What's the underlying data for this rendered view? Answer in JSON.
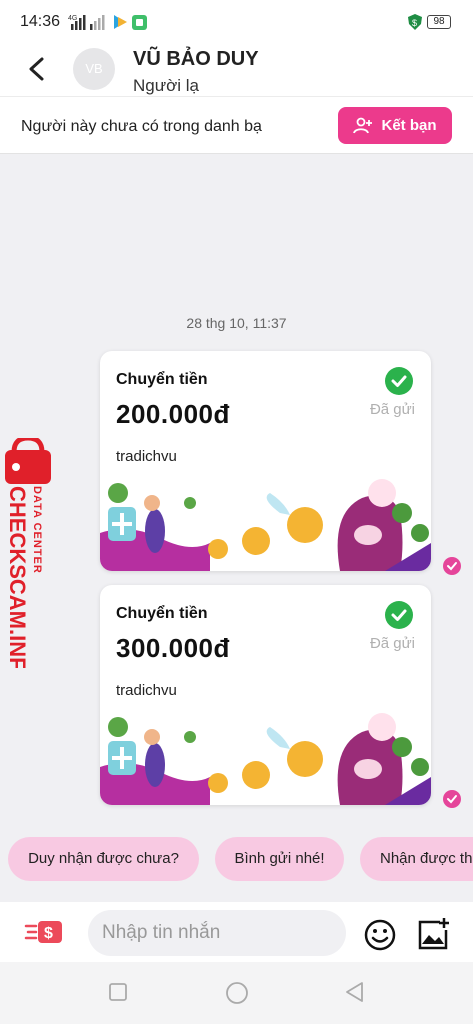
{
  "status_bar": {
    "time": "14:36",
    "battery": "98",
    "network": "4G"
  },
  "header": {
    "avatar_initials": "VB",
    "name": "VŨ BẢO DUY",
    "subtitle": "Người lạ"
  },
  "banner": {
    "text": "Người này chưa có trong danh bạ",
    "button_label": "Kết bạn"
  },
  "chat": {
    "timestamp": "28 thg 10, 11:37",
    "messages": [
      {
        "title": "Chuyển tiền",
        "amount": "200.000đ",
        "memo": "tradichvu",
        "status": "Đã gửi"
      },
      {
        "title": "Chuyển tiền",
        "amount": "300.000đ",
        "memo": "tradichvu",
        "status": "Đã gửi"
      }
    ]
  },
  "watermark": {
    "line1": "DATA CENTER",
    "line2": "CHECKSCAM.INFO"
  },
  "quick_replies": [
    "Duy nhận được chưa?",
    "Bình gửi nhé!",
    "Nhận được th"
  ],
  "input": {
    "placeholder": "Nhập tin nhắn"
  },
  "colors": {
    "accent": "#ec3a8c",
    "chip_bg": "#f8c9e2",
    "success": "#2bb24c",
    "watermark": "#e0202a"
  }
}
